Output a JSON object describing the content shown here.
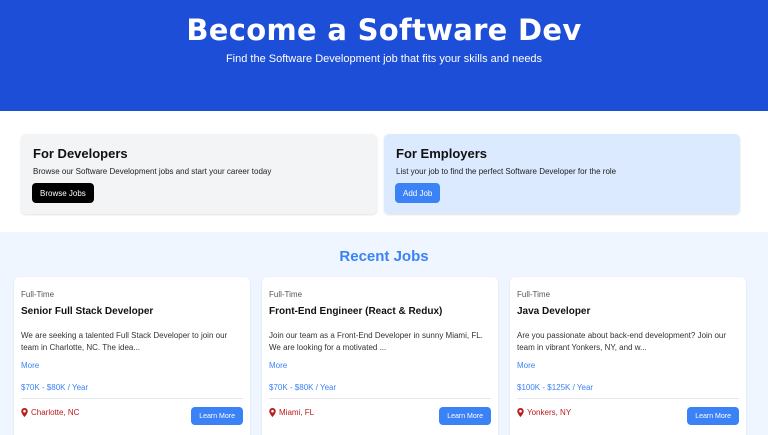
{
  "hero": {
    "title": "Become a Software Dev",
    "subtitle": "Find the Software Development job that fits your skills and needs"
  },
  "cards": {
    "developers": {
      "title": "For Developers",
      "text": "Browse our Software Development jobs and start your career today",
      "button": "Browse Jobs"
    },
    "employers": {
      "title": "For Employers",
      "text": "List your job to find the perfect Software Developer for the role",
      "button": "Add Job"
    }
  },
  "recent": {
    "title": "Recent Jobs",
    "jobs": [
      {
        "type": "Full-Time",
        "title": "Senior Full Stack Developer",
        "description": "We are seeking a talented Full Stack Developer to join our team in Charlotte, NC. The idea...",
        "more": "More",
        "salary": "$70K - $80K / Year",
        "location": "Charlotte, NC",
        "button": "Learn More"
      },
      {
        "type": "Full-Time",
        "title": "Front-End Engineer (React & Redux)",
        "description": "Join our team as a Front-End Developer in sunny Miami, FL. We are looking for a motivated ...",
        "more": "More",
        "salary": "$70K - $80K / Year",
        "location": "Miami, FL",
        "button": "Learn More"
      },
      {
        "type": "Full-Time",
        "title": "Java Developer",
        "description": "Are you passionate about back-end development? Join our team in vibrant Yonkers, NY, and w...",
        "more": "More",
        "salary": "$100K - $125K / Year",
        "location": "Yonkers, NY",
        "button": "Learn More"
      }
    ]
  },
  "colors": {
    "hero_bg": "#1d4ed8",
    "accent": "#3b82f6",
    "location": "#b91c1c"
  },
  "icons": {
    "location": "map-marker-icon"
  }
}
